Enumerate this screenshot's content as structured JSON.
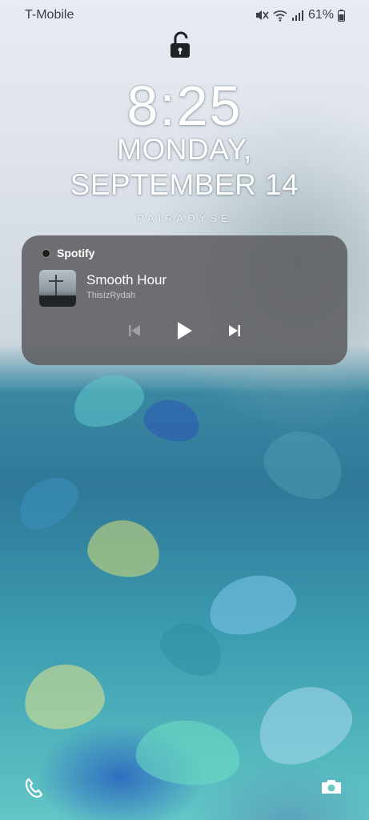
{
  "status_bar": {
    "carrier": "T-Mobile",
    "battery": "61%",
    "icons": [
      "mute-icon",
      "wifi-icon",
      "signal-icon",
      "battery-icon"
    ]
  },
  "lock": {
    "icon": "unlocked-padlock-icon"
  },
  "clock": {
    "time": "8:25",
    "date_line1": "MONDAY,",
    "date_line2": "SEPTEMBER 14"
  },
  "owner_info": "PAIRADYSE",
  "media": {
    "app": "Spotify",
    "track": "Smooth Hour",
    "artist": "ThisIzRydah",
    "controls": [
      "previous-icon",
      "play-icon",
      "next-icon"
    ]
  },
  "shortcuts": {
    "left": "phone-icon",
    "right": "camera-icon"
  },
  "colors": {
    "card": "#5c5c60",
    "text": "#ffffff"
  }
}
